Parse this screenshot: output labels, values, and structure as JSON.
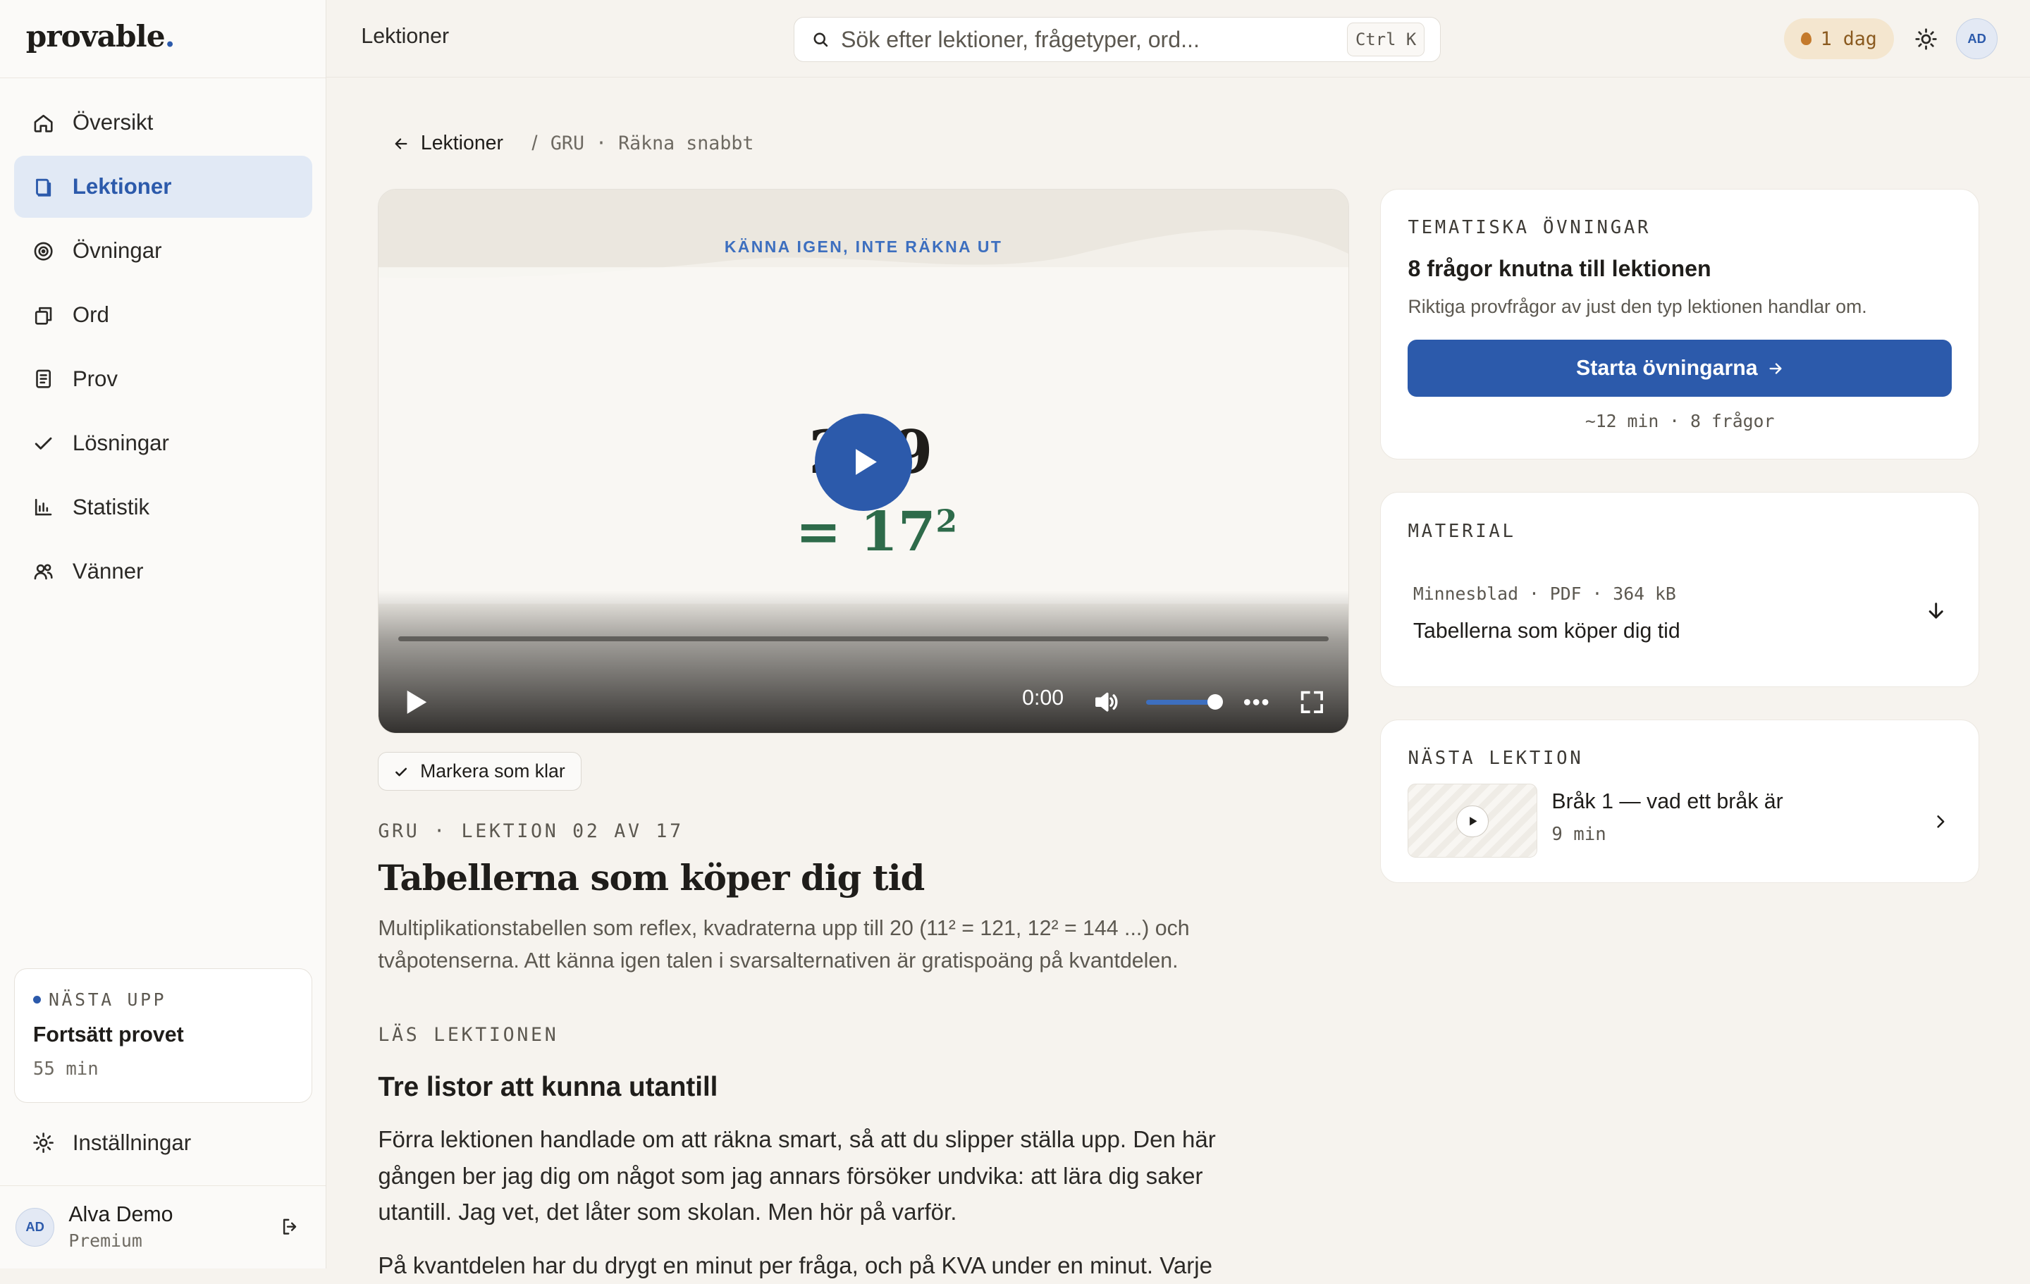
{
  "app": {
    "logo_text": "provable",
    "logo_dot": "."
  },
  "sidebar": {
    "items": [
      {
        "label": "Översikt",
        "icon": "home-icon"
      },
      {
        "label": "Lektioner",
        "icon": "book-icon",
        "active": true
      },
      {
        "label": "Övningar",
        "icon": "target-icon"
      },
      {
        "label": "Ord",
        "icon": "cards-icon"
      },
      {
        "label": "Prov",
        "icon": "document-icon"
      },
      {
        "label": "Lösningar",
        "icon": "check-icon"
      },
      {
        "label": "Statistik",
        "icon": "bar-chart-icon"
      },
      {
        "label": "Vänner",
        "icon": "users-icon"
      }
    ],
    "next_up": {
      "eyebrow": "NÄSTA UPP",
      "title": "Fortsätt provet",
      "subtitle": "55 min"
    },
    "settings_label": "Inställningar",
    "user": {
      "initials": "AD",
      "name": "Alva Demo",
      "plan": "Premium"
    }
  },
  "header": {
    "title": "Lektioner",
    "search_placeholder": "Sök efter lektioner, frågetyper, ord...",
    "search_shortcut": "Ctrl K",
    "streak": "1 dag",
    "avatar_initials": "AD"
  },
  "breadcrumb": {
    "back_label": "Lektioner",
    "separator": "/",
    "current": "GRU · Räkna snabbt"
  },
  "video": {
    "caption": "KÄNNA IGEN, INTE RÄKNA UT",
    "number_back": "289",
    "equation": "= 17",
    "equation_exp": "2",
    "time": "0:00",
    "progress": 0,
    "volume": 0.9
  },
  "lesson": {
    "mark_done_label": "Markera som klar",
    "eyebrow": "GRU · LEKTION 02 AV 17",
    "title": "Tabellerna som köper dig tid",
    "description": "Multiplikationstabellen som reflex, kvadraterna upp till 20 (11² = 121, 12² = 144 ...) och tvåpotenserna. Att känna igen talen i svarsalternativen är gratispoäng på kvantdelen.",
    "read_eyebrow": "LÄS LEKTIONEN",
    "section_title": "Tre listor att kunna utantill",
    "paragraph_1": "Förra lektionen handlade om att räkna smart, så att du slipper ställa upp. Den här gången ber jag dig om något som jag annars försöker undvika: att lära dig saker utantill. Jag vet, det låter som skolan. Men hör på varför.",
    "paragraph_2": "På kvantdelen har du drygt en minut per fråga, och på KVA under en minut. Varje"
  },
  "practice_card": {
    "eyebrow": "TEMATISKA ÖVNINGAR",
    "title": "8 frågor knutna till lektionen",
    "subtitle": "Riktiga provfrågor av just den typ lektionen handlar om.",
    "button_label": "Starta övningarna",
    "meta": "~12 min · 8 frågor"
  },
  "material_card": {
    "eyebrow": "MATERIAL",
    "meta": "Minnesblad · PDF · 364 kB",
    "title": "Tabellerna som köper dig tid"
  },
  "next_lesson_card": {
    "eyebrow": "NÄSTA LEKTION",
    "title": "Bråk 1 — vad ett bråk är",
    "duration": "9 min"
  },
  "colors": {
    "accent": "#2c5aab",
    "background": "#f6f3ee",
    "active_nav_bg": "#e1e9f5",
    "streak_bg": "#f4e6cf",
    "video_number_green": "#2e6b4a"
  }
}
